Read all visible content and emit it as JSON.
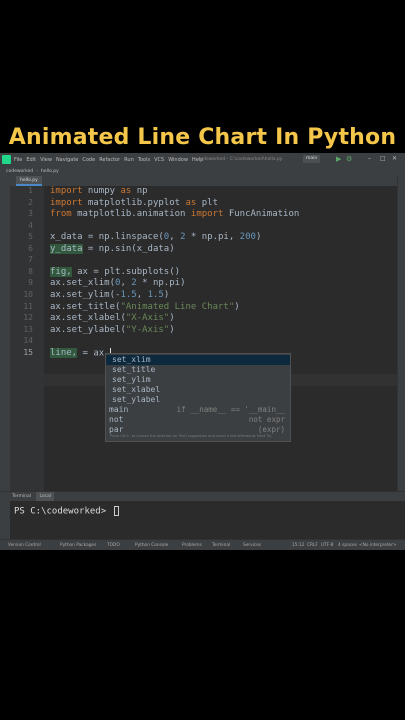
{
  "banner": {
    "title": "Animated Line Chart In Python"
  },
  "menu": {
    "items": [
      "File",
      "Edit",
      "View",
      "Navigate",
      "Code",
      "Refactor",
      "Run",
      "Tools",
      "VCS",
      "Window",
      "Help"
    ],
    "window_title": "codeworked - C:\\codeworked\\hello.py",
    "run_config": "main",
    "run_glyph": "▶",
    "debug_glyph": "⚙"
  },
  "nav": {
    "project": "codeworked",
    "file": "hello.py"
  },
  "tab": {
    "label": "hello.py"
  },
  "editor": {
    "line_numbers": [
      "1",
      "2",
      "3",
      "4",
      "5",
      "6",
      "7",
      "8",
      "9",
      "10",
      "11",
      "12",
      "13",
      "14",
      "15"
    ],
    "current_line": "15",
    "lines": [
      [
        {
          "t": "import",
          "c": "kw"
        },
        {
          "t": " numpy "
        },
        {
          "t": "as",
          "c": "kw"
        },
        {
          "t": " np"
        }
      ],
      [
        {
          "t": "import",
          "c": "kw"
        },
        {
          "t": " matplotlib.pyplot "
        },
        {
          "t": "as",
          "c": "kw"
        },
        {
          "t": " plt"
        }
      ],
      [
        {
          "t": "from",
          "c": "kw"
        },
        {
          "t": " matplotlib.animation "
        },
        {
          "t": "import",
          "c": "kw"
        },
        {
          "t": " FuncAnimation"
        }
      ],
      [],
      [
        {
          "t": "x_data = np.linspace("
        },
        {
          "t": "0",
          "c": "num"
        },
        {
          "t": ", "
        },
        {
          "t": "2",
          "c": "num"
        },
        {
          "t": " * np.pi, "
        },
        {
          "t": "200",
          "c": "num"
        },
        {
          "t": ")"
        }
      ],
      [
        {
          "t": "y_data",
          "c": "var"
        },
        {
          "t": " = np.sin(x_data)"
        }
      ],
      [],
      [
        {
          "t": "fig,",
          "c": "var"
        },
        {
          "t": " ax = plt.subplots()"
        }
      ],
      [
        {
          "t": "ax.set_xlim("
        },
        {
          "t": "0",
          "c": "num"
        },
        {
          "t": ", "
        },
        {
          "t": "2",
          "c": "num"
        },
        {
          "t": " * np.pi)"
        }
      ],
      [
        {
          "t": "ax.set_ylim(-"
        },
        {
          "t": "1.5",
          "c": "num"
        },
        {
          "t": ", "
        },
        {
          "t": "1.5",
          "c": "num"
        },
        {
          "t": ")"
        }
      ],
      [
        {
          "t": "ax.set_title("
        },
        {
          "t": "\"Animated Line Chart\"",
          "c": "str"
        },
        {
          "t": ")"
        }
      ],
      [
        {
          "t": "ax.set_xlabel("
        },
        {
          "t": "\"X-Axis\"",
          "c": "str"
        },
        {
          "t": ")"
        }
      ],
      [
        {
          "t": "ax.set_ylabel("
        },
        {
          "t": "\"Y-Axis\"",
          "c": "str"
        },
        {
          "t": ")"
        }
      ],
      [],
      [
        {
          "t": "line,",
          "c": "var"
        },
        {
          "t": " = ax."
        }
      ]
    ]
  },
  "completion": {
    "items": [
      {
        "name": "set_xlim",
        "tail": ""
      },
      {
        "name": "set_title",
        "tail": ""
      },
      {
        "name": "set_ylim",
        "tail": ""
      },
      {
        "name": "set_xlabel",
        "tail": ""
      },
      {
        "name": "set_ylabel",
        "tail": ""
      },
      {
        "name": "main",
        "tail": "if __name__ == '__main__",
        "kind": "template"
      },
      {
        "name": "not",
        "tail": "not expr",
        "kind": "template"
      },
      {
        "name": "par",
        "tail": "(expr)",
        "kind": "template"
      }
    ],
    "footer": "Press Ctrl+. to choose the selected (or first) suggestion and insert a dot afterwards  Next Tip"
  },
  "terminal": {
    "label": "Terminal",
    "tab": "Local",
    "prompt": "PS C:\\codeworked> "
  },
  "statusbar": {
    "tool_windows": [
      "Version Control",
      "Python Packages",
      "TODO",
      "Python Console",
      "Problems",
      "Terminal",
      "Services"
    ],
    "status": [
      "15:12",
      "CRLF",
      "UTF-8",
      "4 spaces",
      "<No interpreter>"
    ]
  }
}
